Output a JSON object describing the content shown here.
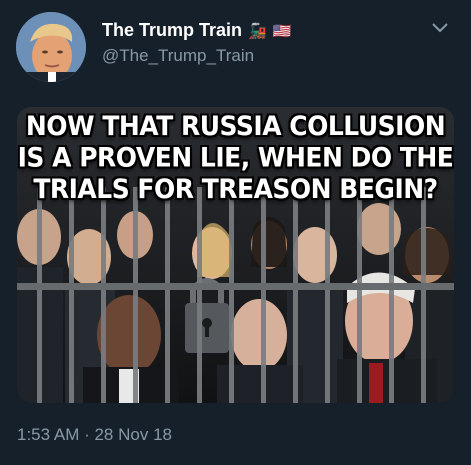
{
  "tweet": {
    "display_name": "The Trump Train",
    "badges": [
      "train-emoji",
      "us-flag-emoji"
    ],
    "badge_glyphs": [
      "🚂",
      "🇺🇸"
    ],
    "handle": "@The_Trump_Train",
    "image_text": "NOW THAT RUSSIA COLLUSION IS A PROVEN LIE, WHEN DO THE TRIALS FOR TREASON BEGIN?",
    "timestamp": "1:53 AM · 28 Nov 18"
  },
  "colors": {
    "background": "#15202b",
    "secondary_text": "#8899a6",
    "primary_text": "#ffffff"
  }
}
